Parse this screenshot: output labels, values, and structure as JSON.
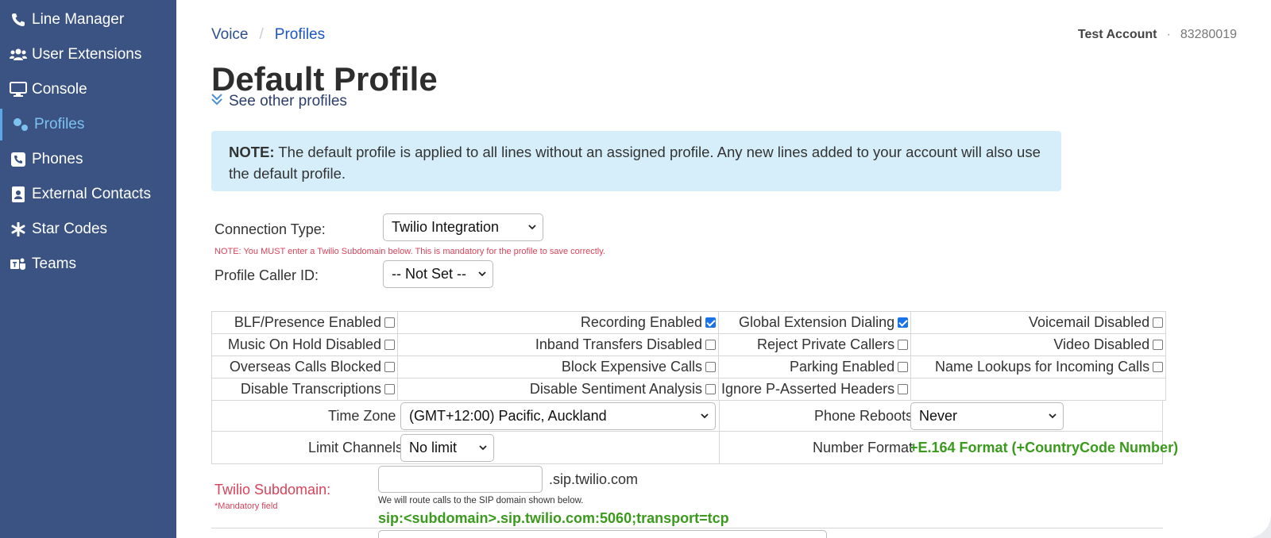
{
  "sidebar": {
    "items": [
      {
        "label": "Line Manager",
        "icon": "phone-icon"
      },
      {
        "label": "User Extensions",
        "icon": "users-icon"
      },
      {
        "label": "Console",
        "icon": "monitor-icon"
      },
      {
        "label": "Profiles",
        "icon": "gears-icon",
        "active": true
      },
      {
        "label": "Phones",
        "icon": "phone-square-icon"
      },
      {
        "label": "External Contacts",
        "icon": "contact-card-icon"
      },
      {
        "label": "Star Codes",
        "icon": "asterisk-icon"
      },
      {
        "label": "Teams",
        "icon": "teams-icon"
      }
    ]
  },
  "breadcrumb": {
    "root": "Voice",
    "sep": "/",
    "current": "Profiles"
  },
  "account": {
    "name": "Test Account",
    "sep": "·",
    "number": "83280019"
  },
  "page": {
    "title": "Default Profile",
    "see_other": "See other profiles"
  },
  "note": {
    "label": "NOTE:",
    "text": " The default profile is applied to all lines without an assigned profile. Any new lines added to your account will also use the default profile."
  },
  "form": {
    "connection_type_label": "Connection Type:",
    "connection_type_value": "Twilio Integration",
    "warning": "NOTE: You MUST enter a Twilio Subdomain below. This is mandatory for the profile to save correctly.",
    "caller_id_label": "Profile Caller ID:",
    "caller_id_value": "-- Not Set --"
  },
  "options": {
    "rows": [
      [
        {
          "label": "BLF/Presence Enabled",
          "checked": false
        },
        {
          "label": "Recording Enabled",
          "checked": true
        },
        {
          "label": "Global Extension Dialing",
          "checked": true
        },
        {
          "label": "Voicemail Disabled",
          "checked": false
        }
      ],
      [
        {
          "label": "Music On Hold Disabled",
          "checked": false
        },
        {
          "label": "Inband Transfers Disabled",
          "checked": false
        },
        {
          "label": "Reject Private Callers",
          "checked": false
        },
        {
          "label": "Video Disabled",
          "checked": false
        }
      ],
      [
        {
          "label": "Overseas Calls Blocked",
          "checked": false
        },
        {
          "label": "Block Expensive Calls",
          "checked": false
        },
        {
          "label": "Parking Enabled",
          "checked": false
        },
        {
          "label": "Name Lookups for Incoming Calls",
          "checked": false
        }
      ],
      [
        {
          "label": "Disable Transcriptions",
          "checked": false
        },
        {
          "label": "Disable Sentiment Analysis",
          "checked": false
        },
        {
          "label": "Ignore P-Asserted Headers",
          "checked": false
        }
      ]
    ],
    "time_zone_label": "Time Zone",
    "time_zone_value": "(GMT+12:00) Pacific, Auckland",
    "phone_reboots_label": "Phone Reboots",
    "phone_reboots_value": "Never",
    "limit_channels_label": "Limit Channels",
    "limit_channels_value": "No limit",
    "number_format_label": "Number Format",
    "number_format_value": "+E.164 Format (+CountryCode Number)"
  },
  "twilio": {
    "label": "Twilio Subdomain:",
    "mandatory": "*Mandatory field",
    "suffix": ".sip.twilio.com",
    "hint": "We will route calls to the SIP domain shown below.",
    "sip_uri": "sip:<subdomain>.sip.twilio.com:5060;transport=tcp",
    "value": ""
  },
  "colors": {
    "sidebar": "#3a5382",
    "accent": "#1a56c4",
    "note_bg": "#d5eefa",
    "warning": "#d9435a",
    "success": "#3a9a1c"
  }
}
